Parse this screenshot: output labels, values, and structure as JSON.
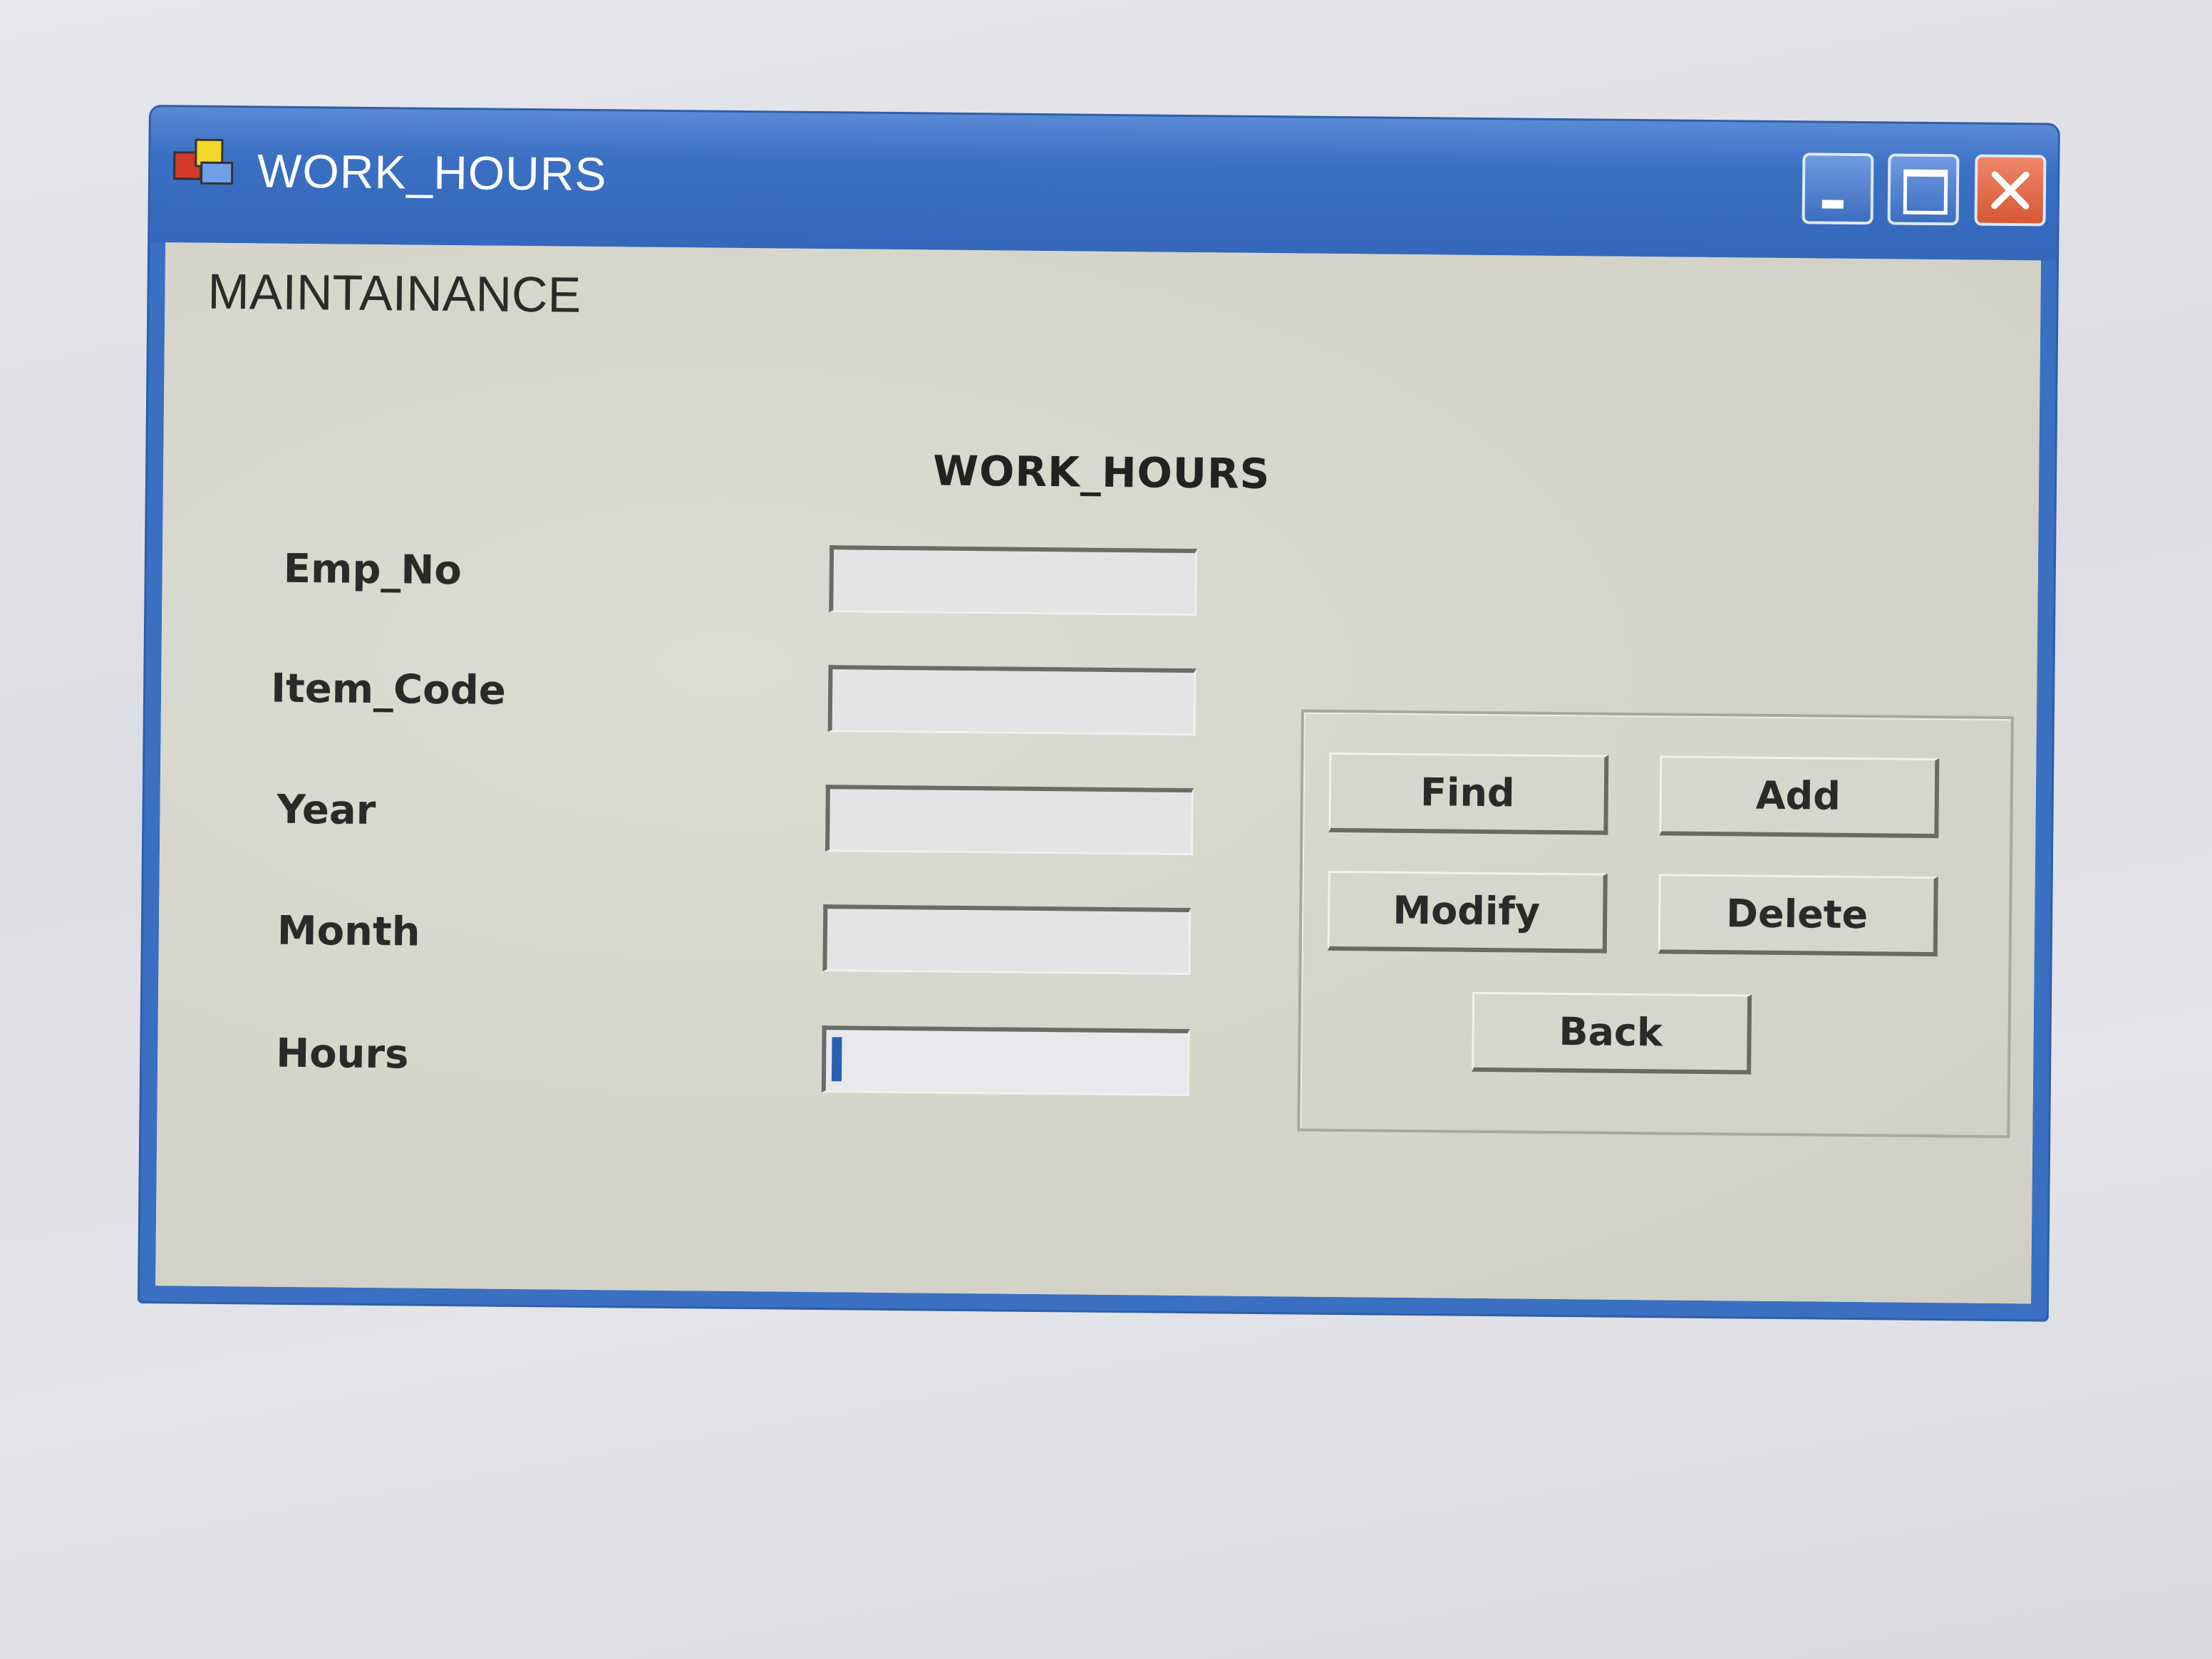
{
  "window": {
    "title": "WORK_HOURS",
    "icon": "app-icon",
    "controls": {
      "minimize_icon": "minimize-icon",
      "maximize_icon": "maximize-icon",
      "close_icon": "close-icon"
    },
    "colors": {
      "titlebar": "#3a6fc2",
      "client": "#d7d7cc",
      "close_button": "#d75834"
    }
  },
  "menu": {
    "items": [
      "MAINTAINANCE"
    ]
  },
  "form": {
    "title": "WORK_HOURS",
    "fields": [
      {
        "label": "Emp_No",
        "value": ""
      },
      {
        "label": "Item_Code",
        "value": ""
      },
      {
        "label": "Year",
        "value": ""
      },
      {
        "label": "Month",
        "value": ""
      },
      {
        "label": "Hours",
        "value": "",
        "focused": true
      }
    ]
  },
  "buttons": {
    "find": "Find",
    "add": "Add",
    "modify": "Modify",
    "delete": "Delete",
    "back": "Back"
  }
}
